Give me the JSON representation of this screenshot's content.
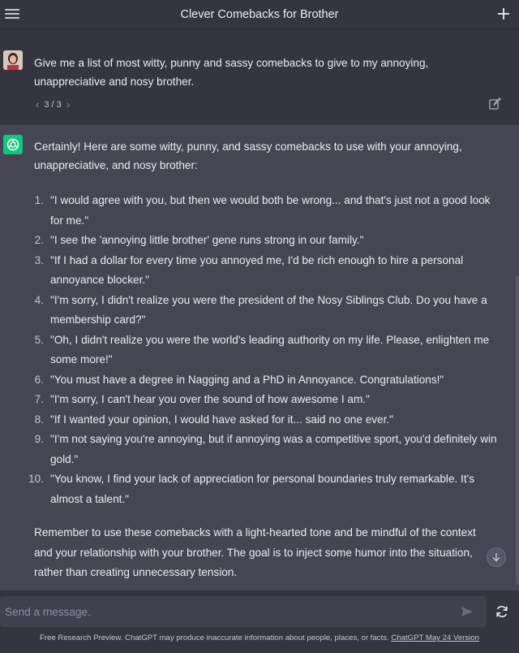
{
  "header": {
    "title": "Clever Comebacks for Brother"
  },
  "user_message": {
    "text": "Give me a list of most witty, punny and sassy comebacks to give to my annoying, unappreciative and nosy brother.",
    "pager": "3 / 3"
  },
  "assistant_message": {
    "intro": "Certainly! Here are some witty, punny, and sassy comebacks to use with your annoying, unappreciative, and nosy brother:",
    "items": [
      {
        "num": "1.",
        "text": "\"I would agree with you, but then we would both be wrong... and that's just not a good look for me.\""
      },
      {
        "num": "2.",
        "text": "\"I see the 'annoying little brother' gene runs strong in our family.\""
      },
      {
        "num": "3.",
        "text": "\"If I had a dollar for every time you annoyed me, I'd be rich enough to hire a personal annoyance blocker.\""
      },
      {
        "num": "4.",
        "text": "\"I'm sorry, I didn't realize you were the president of the Nosy Siblings Club. Do you have a membership card?\""
      },
      {
        "num": "5.",
        "text": "\"Oh, I didn't realize you were the world's leading authority on my life. Please, enlighten me some more!\""
      },
      {
        "num": "6.",
        "text": "\"You must have a degree in Nagging and a PhD in Annoyance. Congratulations!\""
      },
      {
        "num": "7.",
        "text": "\"I'm sorry, I can't hear you over the sound of how awesome I am.\""
      },
      {
        "num": "8.",
        "text": "\"If I wanted your opinion, I would have asked for it... said no one ever.\""
      },
      {
        "num": "9.",
        "text": "\"I'm not saying you're annoying, but if annoying was a competitive sport, you'd definitely win gold.\""
      },
      {
        "num": "10.",
        "text": "\"You know, I find your lack of appreciation for personal boundaries truly remarkable. It's almost a talent.\""
      }
    ],
    "outro": "Remember to use these comebacks with a light-hearted tone and be mindful of the context and your relationship with your brother. The goal is to inject some humor into the situation, rather than creating unnecessary tension."
  },
  "composer": {
    "placeholder": "Send a message."
  },
  "footer": {
    "text": "Free Research Preview. ChatGPT may produce inaccurate information about people, places, or facts. ",
    "link": "ChatGPT May 24 Version"
  },
  "colors": {
    "background": "#343541",
    "assistant_bg": "#444654",
    "accent": "#19c37d"
  },
  "icons": [
    "menu-icon",
    "plus-icon",
    "edit-icon",
    "chatgpt-logo-icon",
    "arrow-down-icon",
    "send-icon",
    "regenerate-icon"
  ]
}
